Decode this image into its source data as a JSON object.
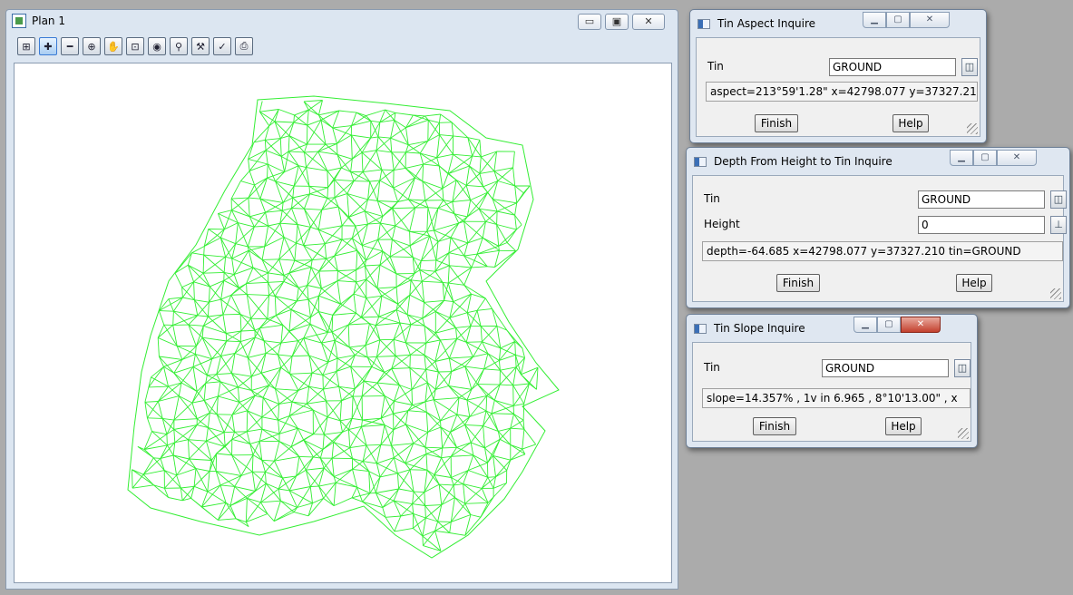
{
  "plan_window": {
    "title": "Plan 1",
    "controls": {
      "minimize": "▭",
      "maximize": "▣",
      "close": "✕"
    },
    "toolbar": [
      {
        "name": "plot-icon",
        "glyph": "⊞"
      },
      {
        "name": "add-view-icon",
        "glyph": "✚"
      },
      {
        "name": "remove-view-icon",
        "glyph": "━"
      },
      {
        "name": "zoom-in-icon",
        "glyph": "⊕"
      },
      {
        "name": "pan-icon",
        "glyph": "✋"
      },
      {
        "name": "zoom-extent-icon",
        "glyph": "⊡"
      },
      {
        "name": "zoom-center-icon",
        "glyph": "◉"
      },
      {
        "name": "search-icon",
        "glyph": "⚲"
      },
      {
        "name": "tools-icon",
        "glyph": "⚒"
      },
      {
        "name": "measure-icon",
        "glyph": "✓"
      },
      {
        "name": "print-icon",
        "glyph": "⎙"
      }
    ],
    "tin_color": "#33ee33"
  },
  "aspect_dialog": {
    "title": "Tin Aspect Inquire",
    "tin_label": "Tin",
    "tin_value": "GROUND",
    "result": "aspect=213°59'1.28\" x=42798.077 y=37327.21",
    "finish_label": "Finish",
    "help_label": "Help"
  },
  "depth_dialog": {
    "title": "Depth From Height to Tin Inquire",
    "tin_label": "Tin",
    "tin_value": "GROUND",
    "height_label": "Height",
    "height_value": "0",
    "result": "depth=-64.685 x=42798.077 y=37327.210 tin=GROUND",
    "finish_label": "Finish",
    "help_label": "Help"
  },
  "slope_dialog": {
    "title": "Tin Slope Inquire",
    "tin_label": "Tin",
    "tin_value": "GROUND",
    "result": "slope=14.357% , 1v in 6.965 , 8°10'13.00\" , x",
    "finish_label": "Finish",
    "help_label": "Help"
  }
}
